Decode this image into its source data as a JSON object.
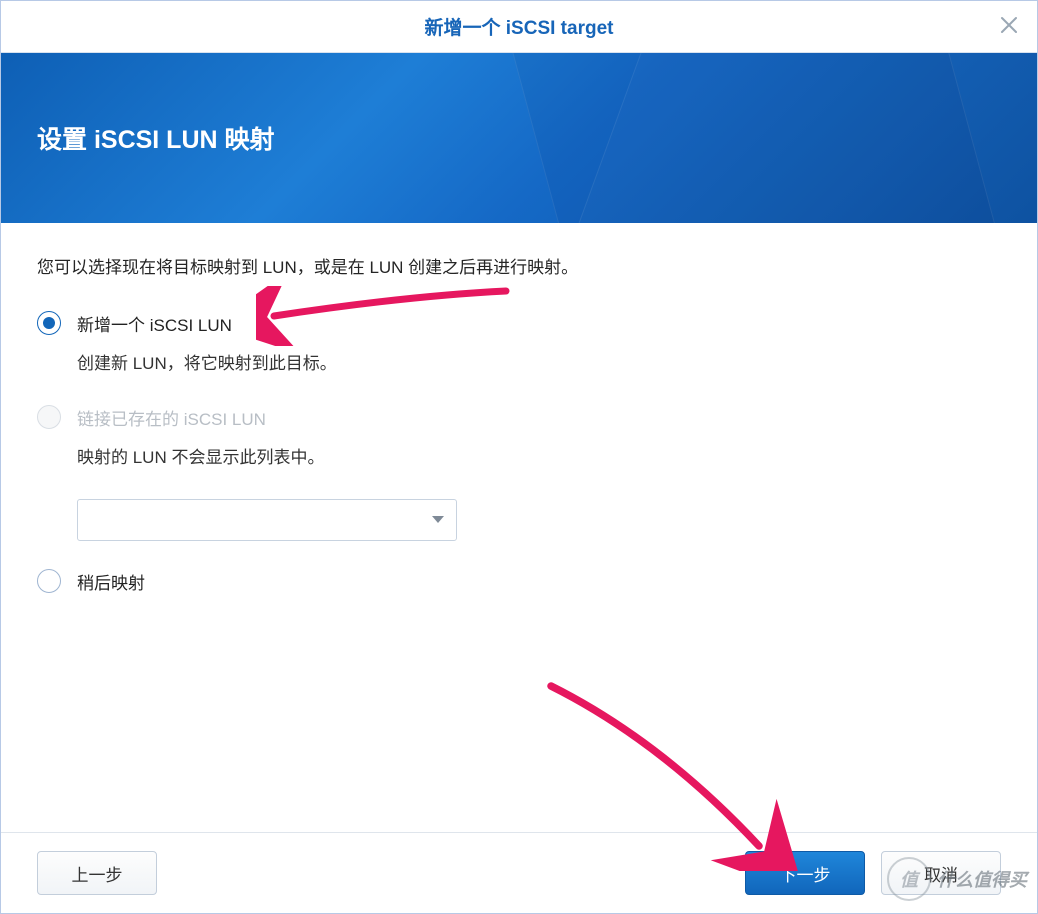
{
  "title": "新增一个 iSCSI target",
  "banner": {
    "heading": "设置 iSCSI LUN 映射"
  },
  "instruction": "您可以选择现在将目标映射到 LUN，或是在 LUN 创建之后再进行映射。",
  "options": {
    "create": {
      "label": "新增一个 iSCSI LUN",
      "desc": "创建新 LUN，将它映射到此目标。",
      "selected": true
    },
    "existing": {
      "label": "链接已存在的 iSCSI LUN",
      "desc": "映射的 LUN 不会显示此列表中。",
      "disabled": true,
      "dropdown_value": ""
    },
    "later": {
      "label": "稍后映射"
    }
  },
  "buttons": {
    "back": "上一步",
    "next": "下一步",
    "cancel": "取消"
  },
  "watermark": {
    "badge": "值",
    "text": "什么值得买"
  }
}
